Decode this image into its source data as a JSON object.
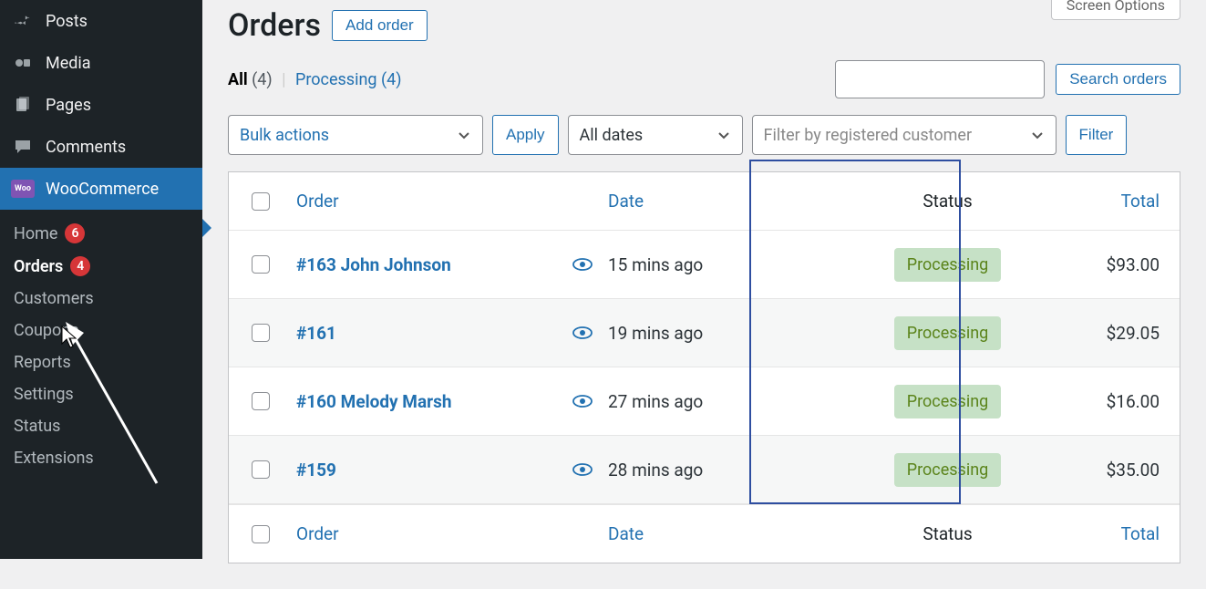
{
  "screen_options_label": "Screen Options",
  "sidebar": {
    "items": [
      {
        "label": "Posts"
      },
      {
        "label": "Media"
      },
      {
        "label": "Pages"
      },
      {
        "label": "Comments"
      },
      {
        "label": "WooCommerce"
      }
    ],
    "woo_sub": [
      {
        "label": "Home",
        "badge": "6"
      },
      {
        "label": "Orders",
        "badge": "4",
        "current": true
      },
      {
        "label": "Customers"
      },
      {
        "label": "Coupons"
      },
      {
        "label": "Reports"
      },
      {
        "label": "Settings"
      },
      {
        "label": "Status"
      },
      {
        "label": "Extensions"
      }
    ],
    "woo_icon_text": "Woo"
  },
  "header": {
    "title": "Orders",
    "add_button": "Add order"
  },
  "status_filters": {
    "all_label": "All",
    "all_count": "(4)",
    "processing_label": "Processing",
    "processing_count": "(4)"
  },
  "search": {
    "button": "Search orders"
  },
  "controls": {
    "bulk_label": "Bulk actions",
    "apply_label": "Apply",
    "dates_label": "All dates",
    "customer_placeholder": "Filter by registered customer",
    "filter_label": "Filter"
  },
  "table": {
    "headers": {
      "order": "Order",
      "date": "Date",
      "status": "Status",
      "total": "Total"
    },
    "rows": [
      {
        "order": "#163 John Johnson",
        "date": "15 mins ago",
        "status": "Processing",
        "total": "$93.00"
      },
      {
        "order": "#161",
        "date": "19 mins ago",
        "status": "Processing",
        "total": "$29.05"
      },
      {
        "order": "#160 Melody Marsh",
        "date": "27 mins ago",
        "status": "Processing",
        "total": "$16.00"
      },
      {
        "order": "#159",
        "date": "28 mins ago",
        "status": "Processing",
        "total": "$35.00"
      }
    ]
  }
}
